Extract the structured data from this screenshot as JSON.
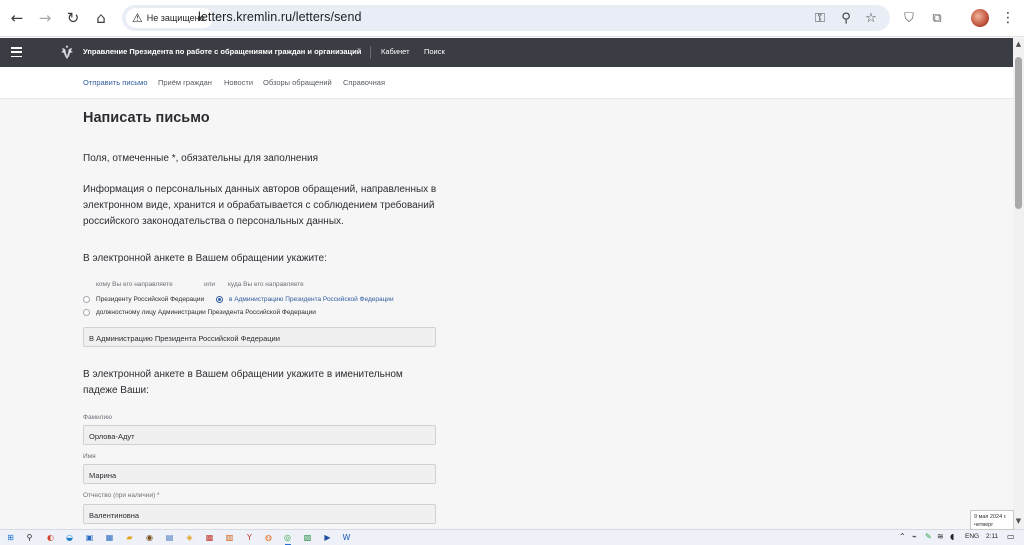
{
  "browser": {
    "secure_label": "Не защищено",
    "url": "letters.kremlin.ru/letters/send",
    "icons": {
      "back": "arrow-left-icon",
      "forward": "arrow-right-icon",
      "reload": "reload-icon",
      "home": "home-icon",
      "warning": "warning-triangle-icon",
      "password": "key-icon",
      "zoom": "magnifier-icon",
      "bookmark": "star-icon",
      "shield": "shield-extension-icon",
      "extensions": "puzzle-icon",
      "menu": "kebab-menu-icon"
    }
  },
  "header": {
    "title": "Управление Президента по работе с обращениями граждан и организаций",
    "links": [
      "Кабинет",
      "Поиск"
    ]
  },
  "subnav": {
    "items": [
      "Отправить письмо",
      "Приём граждан",
      "Новости",
      "Обзоры обращений",
      "Справочная"
    ],
    "active": "Отправить письмо"
  },
  "main": {
    "title": "Написать письмо",
    "required_note": "Поля, отмеченные *, обязательны для заполнения",
    "privacy_text": "Информация о персональных данных авторов обращений, направленных в электронном виде, хранится и обрабатывается с соблюдением требований российского законодательства о персональных данных.",
    "section1": "В электронной анкете в Вашем обращении укажите:",
    "radio": {
      "caption_whom": "кому Вы его направляете",
      "caption_or": "или",
      "caption_where": "куда Вы его направляете",
      "options": [
        "Президенту Российской Федерации",
        "в Администрацию Президента Российской Федерации",
        "должностному лицу Администрации Президента Российской Федерации"
      ],
      "selected_index": 1
    },
    "recipient_value": "В Администрацию Президента Российской Федерации",
    "section2": "В электронной анкете в Вашем обращении укажите в именительном падеже Ваши:",
    "fields": {
      "surname_label": "Фамилию",
      "surname_value": "Орлова-Адут",
      "name_label": "Имя",
      "name_value": "Марина",
      "patronymic_label": "Отчество (при наличии) *",
      "patronymic_value": "Валентиновна"
    }
  },
  "system": {
    "date_line1": "9 мая 2024 г.",
    "date_line2": "четверг",
    "language": "ENG",
    "time": "2:11"
  }
}
